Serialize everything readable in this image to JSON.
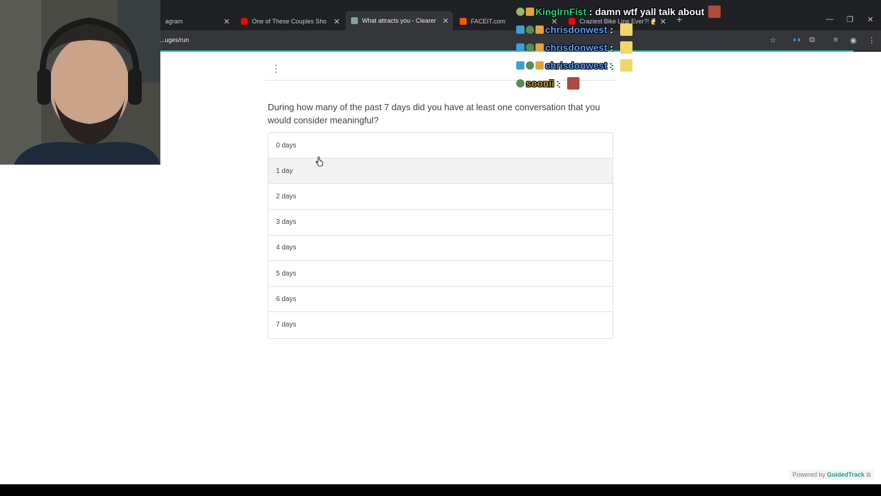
{
  "browser": {
    "tabs": [
      {
        "title": "agram",
        "active": false
      },
      {
        "title": "One of These Couples Shouldn't",
        "active": false
      },
      {
        "title": "What attracts you - Clearer Thi",
        "active": true
      },
      {
        "title": "FACEIT.com",
        "active": false
      },
      {
        "title": "Craziest Bike Line Ever?! 😱 - Yo",
        "active": false
      }
    ],
    "url": "...uges/run",
    "new_tab_label": "+"
  },
  "survey": {
    "question": "During how many of the past 7 days did you have at least one conversation that you would consider meaningful?",
    "options": [
      "0 days",
      "1 day",
      "2 days",
      "3 days",
      "4 days",
      "5 days",
      "6 days",
      "7 days"
    ],
    "hovered_option": "1 day"
  },
  "footer": {
    "powered_prefix": "Powered by",
    "brand": "GuidedTrack"
  },
  "chat": [
    {
      "user": "KingIrnFist",
      "color": "#2ecc71",
      "text": "damn wtf yall talk about"
    },
    {
      "user": "chrisdonwest",
      "color": "#5b9cf5",
      "text": ""
    },
    {
      "user": "chrisdonwest",
      "color": "#5b9cf5",
      "text": ""
    },
    {
      "user": "chrisdonwest",
      "color": "#5b9cf5",
      "text": ""
    },
    {
      "user": "soonii",
      "color": "#b8a23a",
      "text": ""
    }
  ],
  "colors": {
    "accent": "#1aa9a0",
    "brand": "#1e9a8e"
  }
}
